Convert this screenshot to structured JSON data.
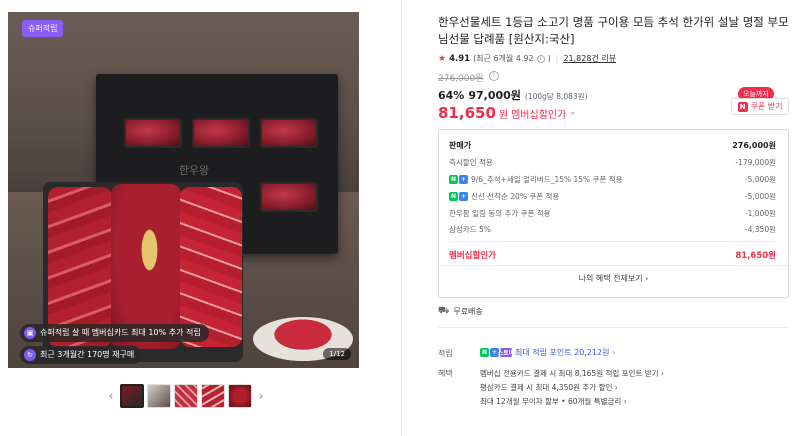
{
  "gallery": {
    "super_badge": "슈퍼적립",
    "box_brand": "한우왕",
    "promo_1": "슈퍼적립 살 때 멤버십카드 최대 10% 추가 적립",
    "promo_2": "최근 3개월간 170명 재구매",
    "page_indicator": "1/12",
    "prev_icon": "‹",
    "next_icon": "›",
    "thumbnail_count": 5
  },
  "product": {
    "title": "한우선물세트 1등급 소고기 명품 구이용 모듬 추석 한가위 설날 명절 부모님선물 답례품 [원산지:국산]",
    "rating_score": "4.91",
    "rating_recent": "(최근 6개월 4.92",
    "rating_recent_close": ")",
    "review_count": "21,828건 리뷰",
    "original_price": "276,000원",
    "discount_pct": "64%",
    "discount_price": "97,000원",
    "unit_price": "(100g당 8,083원)",
    "member_price": "81,650",
    "member_price_won": "원",
    "member_price_label": "멤버십할인가",
    "today_badge": "오늘까지",
    "coupon_button": "쿠폰 받기"
  },
  "price_panel": {
    "rows": [
      {
        "label": "판매가",
        "value": "276,000원"
      },
      {
        "label": "즉시할인 적용",
        "value": "-179,000원"
      },
      {
        "label": "9/6_추석+세일 얼리버드_15% 15% 쿠폰 적용",
        "value": "-5,000원"
      },
      {
        "label": "신선 선착순 20% 쿠폰 적용",
        "value": "-5,000원"
      },
      {
        "label": "한우팜 일림 동의 추가 쿠폰 적용",
        "value": "-1,000원"
      },
      {
        "label": "삼성카드 5%",
        "value": "-4,350원"
      },
      {
        "label": "멤버십할인가",
        "value": "81,650원"
      }
    ],
    "benefit_link": "나의 혜택 전체보기 ›"
  },
  "shipping": {
    "label": "무료배송"
  },
  "points": {
    "label": "적립",
    "value": "최대 적립 포인트 20,212원",
    "badge_1": "N",
    "badge_2": "+",
    "badge_3": "스토어"
  },
  "benefits": {
    "label": "혜택",
    "items": [
      "멤버십 전용카드 결제 시 최대 8,165원 적립 포인트 받기 ›",
      "평삼카드 결제 시 최대 4,350원 추가 할인 ›",
      "최대 12개월 무이자 할부 • 60개월 특별금리 ›"
    ]
  },
  "colors": {
    "accent_red": "#f02d4a",
    "naver_green": "#03c75a",
    "super_purple": "#8b5cf6",
    "point_blue": "#3b5bdb"
  }
}
